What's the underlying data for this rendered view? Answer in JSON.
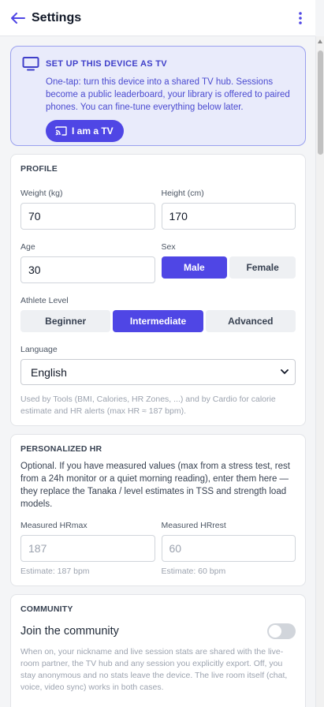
{
  "header": {
    "title": "Settings"
  },
  "tv_card": {
    "title": "SET UP THIS DEVICE AS TV",
    "description": "One-tap: turn this device into a shared TV hub. Sessions become a public leaderboard, your library is offered to paired phones. You can fine-tune everything below later.",
    "button_label": "I am a TV"
  },
  "profile": {
    "title": "PROFILE",
    "weight_label": "Weight (kg)",
    "weight_value": "70",
    "height_label": "Height (cm)",
    "height_value": "170",
    "age_label": "Age",
    "age_value": "30",
    "sex_label": "Sex",
    "sex_options": [
      "Male",
      "Female"
    ],
    "sex_selected": "Male",
    "level_label": "Athlete Level",
    "level_options": [
      "Beginner",
      "Intermediate",
      "Advanced"
    ],
    "level_selected": "Intermediate",
    "language_label": "Language",
    "language_value": "English",
    "note": "Used by Tools (BMI, Calories, HR Zones, ...) and by Cardio for calorie estimate and HR alerts (max HR ≈ 187 bpm)."
  },
  "personalized_hr": {
    "title": "PERSONALIZED HR",
    "description": "Optional. If you have measured values (max from a stress test, rest from a 24h monitor or a quiet morning reading), enter them here — they replace the Tanaka / level estimates in TSS and strength load models.",
    "hrmax_label": "Measured HRmax",
    "hrmax_placeholder": "187",
    "hrmax_estimate": "Estimate: 187 bpm",
    "hrrest_label": "Measured HRrest",
    "hrrest_placeholder": "60",
    "hrrest_estimate": "Estimate: 60 bpm"
  },
  "community": {
    "title": "COMMUNITY",
    "toggle_label": "Join the community",
    "toggle_on": false,
    "description": "When on, your nickname and live session stats are shared with the live-room partner, the TV hub and any session you explicitly export. Off, you stay anonymous and no stats leave the device. The live room itself (chat, voice, video sync) works in both cases."
  },
  "colors": {
    "accent": "#4f46e5",
    "tv_bg": "#e9ebfb",
    "tv_text": "#4b4bd0"
  }
}
